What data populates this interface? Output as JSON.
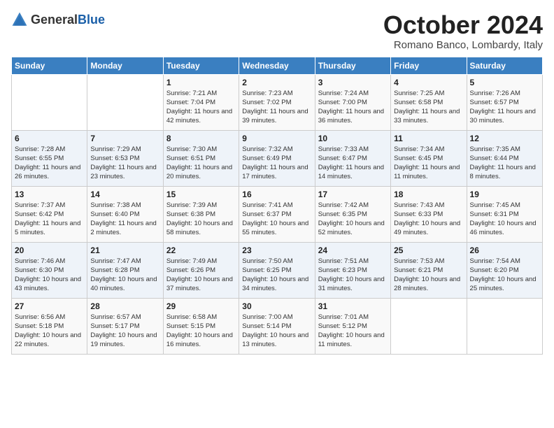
{
  "header": {
    "logo_general": "General",
    "logo_blue": "Blue",
    "month_title": "October 2024",
    "location": "Romano Banco, Lombardy, Italy"
  },
  "days_of_week": [
    "Sunday",
    "Monday",
    "Tuesday",
    "Wednesday",
    "Thursday",
    "Friday",
    "Saturday"
  ],
  "weeks": [
    [
      {
        "day": "",
        "content": ""
      },
      {
        "day": "",
        "content": ""
      },
      {
        "day": "1",
        "content": "Sunrise: 7:21 AM\nSunset: 7:04 PM\nDaylight: 11 hours and 42 minutes."
      },
      {
        "day": "2",
        "content": "Sunrise: 7:23 AM\nSunset: 7:02 PM\nDaylight: 11 hours and 39 minutes."
      },
      {
        "day": "3",
        "content": "Sunrise: 7:24 AM\nSunset: 7:00 PM\nDaylight: 11 hours and 36 minutes."
      },
      {
        "day": "4",
        "content": "Sunrise: 7:25 AM\nSunset: 6:58 PM\nDaylight: 11 hours and 33 minutes."
      },
      {
        "day": "5",
        "content": "Sunrise: 7:26 AM\nSunset: 6:57 PM\nDaylight: 11 hours and 30 minutes."
      }
    ],
    [
      {
        "day": "6",
        "content": "Sunrise: 7:28 AM\nSunset: 6:55 PM\nDaylight: 11 hours and 26 minutes."
      },
      {
        "day": "7",
        "content": "Sunrise: 7:29 AM\nSunset: 6:53 PM\nDaylight: 11 hours and 23 minutes."
      },
      {
        "day": "8",
        "content": "Sunrise: 7:30 AM\nSunset: 6:51 PM\nDaylight: 11 hours and 20 minutes."
      },
      {
        "day": "9",
        "content": "Sunrise: 7:32 AM\nSunset: 6:49 PM\nDaylight: 11 hours and 17 minutes."
      },
      {
        "day": "10",
        "content": "Sunrise: 7:33 AM\nSunset: 6:47 PM\nDaylight: 11 hours and 14 minutes."
      },
      {
        "day": "11",
        "content": "Sunrise: 7:34 AM\nSunset: 6:45 PM\nDaylight: 11 hours and 11 minutes."
      },
      {
        "day": "12",
        "content": "Sunrise: 7:35 AM\nSunset: 6:44 PM\nDaylight: 11 hours and 8 minutes."
      }
    ],
    [
      {
        "day": "13",
        "content": "Sunrise: 7:37 AM\nSunset: 6:42 PM\nDaylight: 11 hours and 5 minutes."
      },
      {
        "day": "14",
        "content": "Sunrise: 7:38 AM\nSunset: 6:40 PM\nDaylight: 11 hours and 2 minutes."
      },
      {
        "day": "15",
        "content": "Sunrise: 7:39 AM\nSunset: 6:38 PM\nDaylight: 10 hours and 58 minutes."
      },
      {
        "day": "16",
        "content": "Sunrise: 7:41 AM\nSunset: 6:37 PM\nDaylight: 10 hours and 55 minutes."
      },
      {
        "day": "17",
        "content": "Sunrise: 7:42 AM\nSunset: 6:35 PM\nDaylight: 10 hours and 52 minutes."
      },
      {
        "day": "18",
        "content": "Sunrise: 7:43 AM\nSunset: 6:33 PM\nDaylight: 10 hours and 49 minutes."
      },
      {
        "day": "19",
        "content": "Sunrise: 7:45 AM\nSunset: 6:31 PM\nDaylight: 10 hours and 46 minutes."
      }
    ],
    [
      {
        "day": "20",
        "content": "Sunrise: 7:46 AM\nSunset: 6:30 PM\nDaylight: 10 hours and 43 minutes."
      },
      {
        "day": "21",
        "content": "Sunrise: 7:47 AM\nSunset: 6:28 PM\nDaylight: 10 hours and 40 minutes."
      },
      {
        "day": "22",
        "content": "Sunrise: 7:49 AM\nSunset: 6:26 PM\nDaylight: 10 hours and 37 minutes."
      },
      {
        "day": "23",
        "content": "Sunrise: 7:50 AM\nSunset: 6:25 PM\nDaylight: 10 hours and 34 minutes."
      },
      {
        "day": "24",
        "content": "Sunrise: 7:51 AM\nSunset: 6:23 PM\nDaylight: 10 hours and 31 minutes."
      },
      {
        "day": "25",
        "content": "Sunrise: 7:53 AM\nSunset: 6:21 PM\nDaylight: 10 hours and 28 minutes."
      },
      {
        "day": "26",
        "content": "Sunrise: 7:54 AM\nSunset: 6:20 PM\nDaylight: 10 hours and 25 minutes."
      }
    ],
    [
      {
        "day": "27",
        "content": "Sunrise: 6:56 AM\nSunset: 5:18 PM\nDaylight: 10 hours and 22 minutes."
      },
      {
        "day": "28",
        "content": "Sunrise: 6:57 AM\nSunset: 5:17 PM\nDaylight: 10 hours and 19 minutes."
      },
      {
        "day": "29",
        "content": "Sunrise: 6:58 AM\nSunset: 5:15 PM\nDaylight: 10 hours and 16 minutes."
      },
      {
        "day": "30",
        "content": "Sunrise: 7:00 AM\nSunset: 5:14 PM\nDaylight: 10 hours and 13 minutes."
      },
      {
        "day": "31",
        "content": "Sunrise: 7:01 AM\nSunset: 5:12 PM\nDaylight: 10 hours and 11 minutes."
      },
      {
        "day": "",
        "content": ""
      },
      {
        "day": "",
        "content": ""
      }
    ]
  ]
}
